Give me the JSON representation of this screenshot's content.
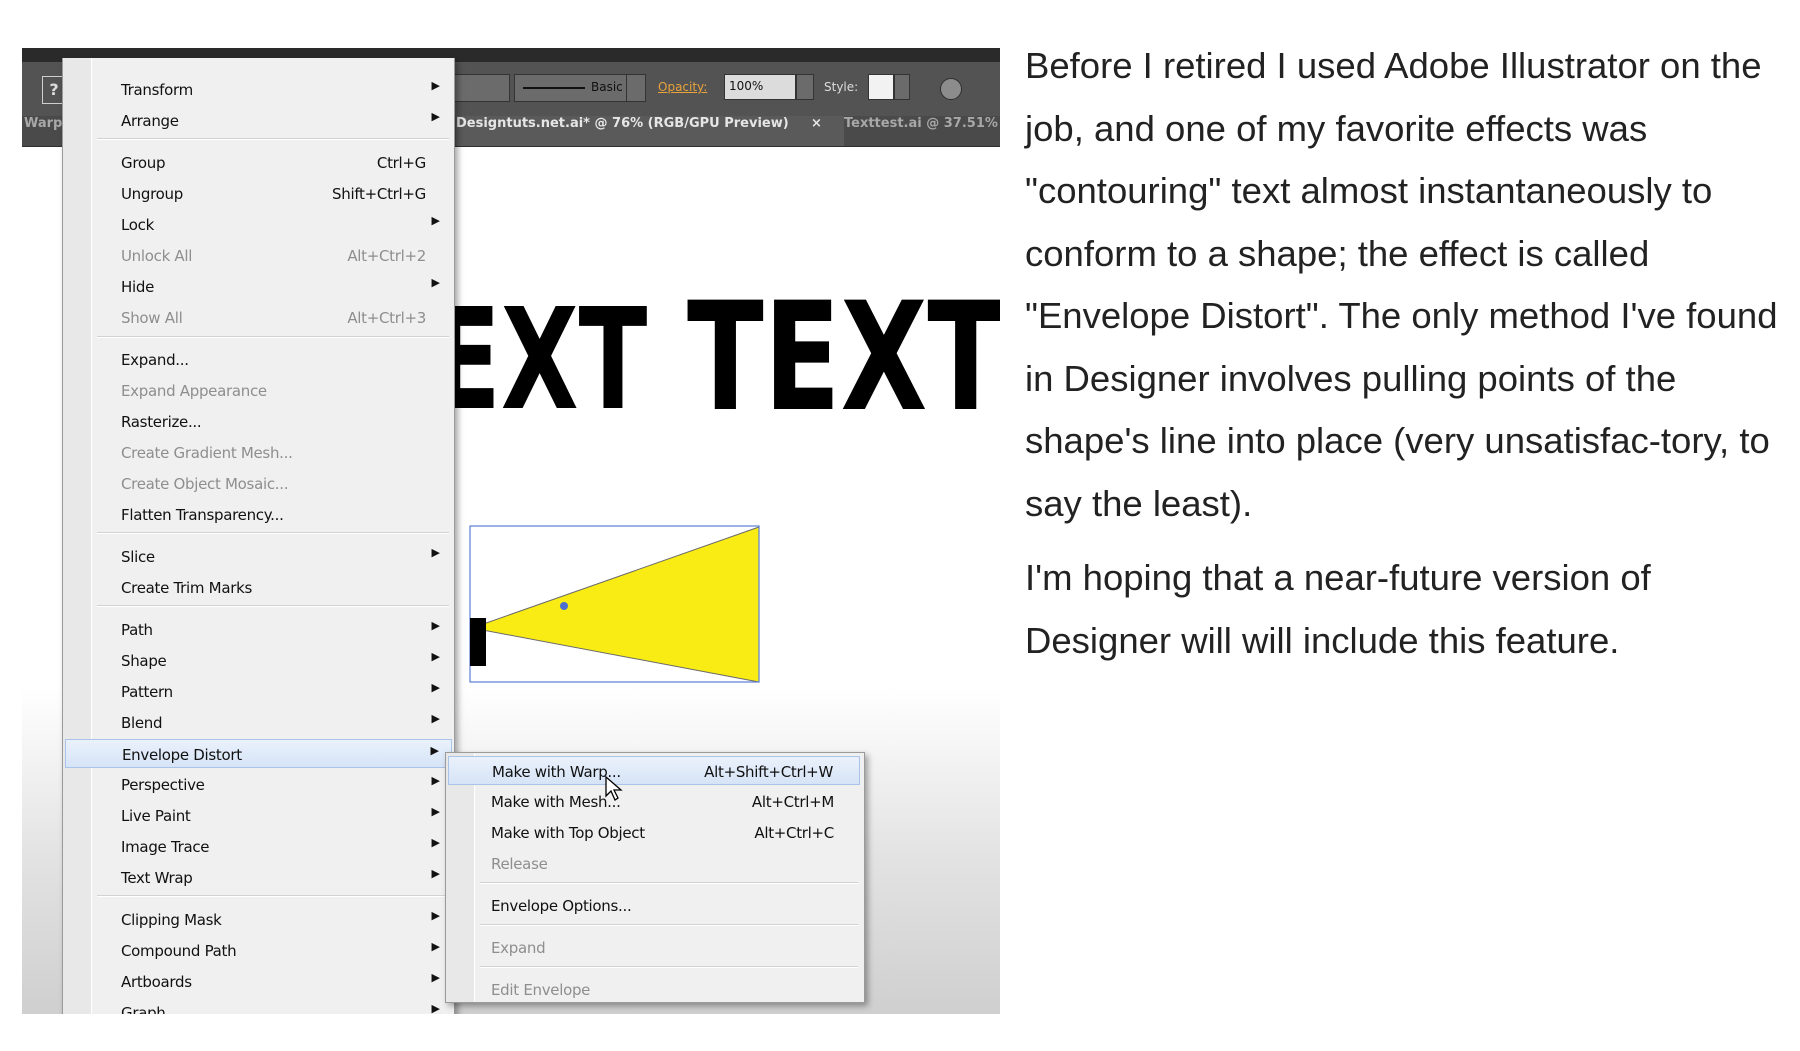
{
  "toolbar": {
    "help_glyph": "?",
    "stroke_style": "Basic",
    "opacity_label": "Opacity:",
    "opacity_value": "100%",
    "style_label": "Style:"
  },
  "doc_tabs": [
    {
      "label": "Warp",
      "active": false
    },
    {
      "label": "Designtuts.net.ai* @ 76% (RGB/GPU Preview)",
      "active": true
    },
    {
      "label": "×",
      "active": true
    },
    {
      "label": "Texttest.ai @ 37.51%",
      "active": false
    }
  ],
  "canvas": {
    "warped_text": "EXT",
    "plain_text": "TEXT",
    "shape_fill": "#f9ec14",
    "selection_color": "#4a6fd1"
  },
  "object_menu": {
    "items": [
      {
        "label": "Transform",
        "shortcut": "",
        "submenu": true,
        "disabled": false
      },
      {
        "label": "Arrange",
        "shortcut": "",
        "submenu": true,
        "disabled": false
      },
      {
        "label": "Group",
        "shortcut": "Ctrl+G",
        "submenu": false,
        "disabled": false
      },
      {
        "label": "Ungroup",
        "shortcut": "Shift+Ctrl+G",
        "submenu": false,
        "disabled": false
      },
      {
        "label": "Lock",
        "shortcut": "",
        "submenu": true,
        "disabled": false
      },
      {
        "label": "Unlock All",
        "shortcut": "Alt+Ctrl+2",
        "submenu": false,
        "disabled": true
      },
      {
        "label": "Hide",
        "shortcut": "",
        "submenu": true,
        "disabled": false
      },
      {
        "label": "Show All",
        "shortcut": "Alt+Ctrl+3",
        "submenu": false,
        "disabled": true
      },
      {
        "label": "Expand...",
        "shortcut": "",
        "submenu": false,
        "disabled": false
      },
      {
        "label": "Expand Appearance",
        "shortcut": "",
        "submenu": false,
        "disabled": true
      },
      {
        "label": "Rasterize...",
        "shortcut": "",
        "submenu": false,
        "disabled": false
      },
      {
        "label": "Create Gradient Mesh...",
        "shortcut": "",
        "submenu": false,
        "disabled": true
      },
      {
        "label": "Create Object Mosaic...",
        "shortcut": "",
        "submenu": false,
        "disabled": true
      },
      {
        "label": "Flatten Transparency...",
        "shortcut": "",
        "submenu": false,
        "disabled": false
      },
      {
        "label": "Slice",
        "shortcut": "",
        "submenu": true,
        "disabled": false
      },
      {
        "label": "Create Trim Marks",
        "shortcut": "",
        "submenu": false,
        "disabled": false
      },
      {
        "label": "Path",
        "shortcut": "",
        "submenu": true,
        "disabled": false
      },
      {
        "label": "Shape",
        "shortcut": "",
        "submenu": true,
        "disabled": false
      },
      {
        "label": "Pattern",
        "shortcut": "",
        "submenu": true,
        "disabled": false
      },
      {
        "label": "Blend",
        "shortcut": "",
        "submenu": true,
        "disabled": false
      },
      {
        "label": "Envelope Distort",
        "shortcut": "",
        "submenu": true,
        "disabled": false,
        "highlighted": true
      },
      {
        "label": "Perspective",
        "shortcut": "",
        "submenu": true,
        "disabled": false
      },
      {
        "label": "Live Paint",
        "shortcut": "",
        "submenu": true,
        "disabled": false
      },
      {
        "label": "Image Trace",
        "shortcut": "",
        "submenu": true,
        "disabled": false
      },
      {
        "label": "Text Wrap",
        "shortcut": "",
        "submenu": true,
        "disabled": false
      },
      {
        "label": "Clipping Mask",
        "shortcut": "",
        "submenu": true,
        "disabled": false
      },
      {
        "label": "Compound Path",
        "shortcut": "",
        "submenu": true,
        "disabled": false
      },
      {
        "label": "Artboards",
        "shortcut": "",
        "submenu": true,
        "disabled": false
      },
      {
        "label": "Graph",
        "shortcut": "",
        "submenu": true,
        "disabled": false
      }
    ]
  },
  "envelope_submenu": {
    "items": [
      {
        "label": "Make with Warp...",
        "shortcut": "Alt+Shift+Ctrl+W",
        "disabled": false,
        "highlighted": true
      },
      {
        "label": "Make with Mesh...",
        "shortcut": "Alt+Ctrl+M",
        "disabled": false
      },
      {
        "label": "Make with Top Object",
        "shortcut": "Alt+Ctrl+C",
        "disabled": false
      },
      {
        "label": "Release",
        "shortcut": "",
        "disabled": true
      },
      {
        "label": "Envelope Options...",
        "shortcut": "",
        "disabled": false
      },
      {
        "label": "Expand",
        "shortcut": "",
        "disabled": true
      },
      {
        "label": "Edit Envelope",
        "shortcut": "",
        "disabled": true
      }
    ]
  },
  "article": {
    "paragraphs": [
      "Before I retired I used Adobe Illustrator on the job, and one of my favorite effects was \"contouring\" text almost instantaneously to conform to a shape; the effect is called \"Envelope Distort\". The only method I've found in Designer involves pulling points of the shape's line into place (very unsatisfac-tory, to say the least).",
      "I'm hoping that a near-future version of Designer will will include this feature."
    ]
  }
}
